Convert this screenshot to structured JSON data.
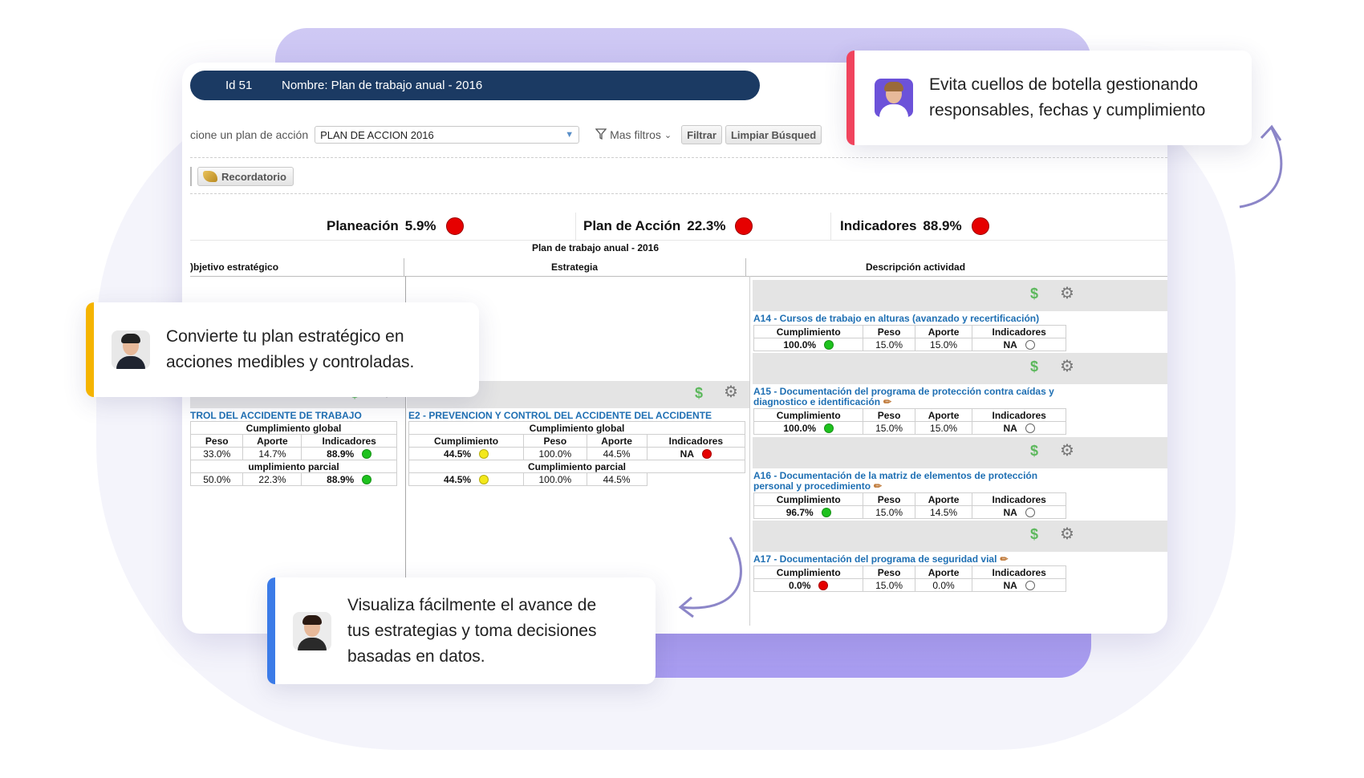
{
  "header": {
    "id_label": "Id 51",
    "name_label": "Nombre: Plan de trabajo anual - 2016"
  },
  "filters": {
    "plan_label": "cione un plan de acción",
    "plan_value": "PLAN DE ACCION 2016",
    "more_filters": "Mas filtros",
    "filter_button": "Filtrar",
    "clear_button": "Limpiar Búsqued"
  },
  "reminder_button": "Recordatorio",
  "kpis": [
    {
      "label": "Planeación",
      "value": "5.9%",
      "status_color": "#e60000"
    },
    {
      "label": "Plan de Acción",
      "value": "22.3%",
      "status_color": "#e60000"
    },
    {
      "label": "Indicadores",
      "value": "88.9%",
      "status_color": "#e60000"
    }
  ],
  "plan_title": "Plan de trabajo anual - 2016",
  "columns": {
    "objective": ")bjetivo estratégico",
    "strategy": "Estrategia",
    "activity": "Descripción actividad"
  },
  "objective": {
    "title": "TROL DEL ACCIDENTE DE TRABAJO",
    "global_label": "Cumplimiento global",
    "headers": [
      "Peso",
      "Aporte",
      "Indicadores"
    ],
    "global_row": [
      "33.0%",
      "14.7%",
      "88.9%"
    ],
    "partial_label": "umplimiento parcial",
    "partial_row": [
      "50.0%",
      "22.3%",
      "88.9%"
    ]
  },
  "strategy": {
    "title": "E2 - PREVENCION Y CONTROL DEL ACCIDENTE DEL ACCIDENTE",
    "global_label": "Cumplimiento global",
    "headers": [
      "Cumplimiento",
      "Peso",
      "Aporte",
      "Indicadores"
    ],
    "global_row": [
      "44.5%",
      "100.0%",
      "44.5%",
      "NA"
    ],
    "partial_label": "Cumplimiento parcial",
    "partial_row": [
      "44.5%",
      "100.0%",
      "44.5%"
    ]
  },
  "activity_headers": [
    "Cumplimiento",
    "Peso",
    "Aporte",
    "Indicadores"
  ],
  "activities": [
    {
      "title": "A14 - Cursos de trabajo en alturas (avanzado y recertificación)",
      "title2": "",
      "row": [
        "100.0%",
        "15.0%",
        "15.0%",
        "NA"
      ]
    },
    {
      "title": "A15 - Documentación del programa de protección contra caídas y",
      "title2": "diagnostico e identificación",
      "row": [
        "100.0%",
        "15.0%",
        "15.0%",
        "NA"
      ]
    },
    {
      "title": "A16 - Documentación de la matriz de elementos de protección",
      "title2": "personal y procedimiento",
      "row": [
        "96.7%",
        "15.0%",
        "14.5%",
        "NA"
      ]
    },
    {
      "title": "A17 - Documentación del programa de seguridad vial",
      "title2": "",
      "row": [
        "0.0%",
        "15.0%",
        "0.0%",
        "NA"
      ]
    }
  ],
  "icons": {
    "money": "$",
    "settings": "⚙",
    "pencil": "✏",
    "funnel": "⏷",
    "chevron": "⌄"
  },
  "callouts": {
    "top_right": {
      "line1": "Evita cuellos de botella gestionando",
      "line2": "responsables, fechas y cumplimiento",
      "accent": "#f0445d"
    },
    "left": {
      "line1": "Convierte tu plan estratégico en",
      "line2": "acciones medibles y controladas.",
      "accent": "#f5b400"
    },
    "bottom": {
      "line1": "Visualiza fácilmente el avance de",
      "line2": "tus estrategias y toma decisiones",
      "line3": "basadas en datos.",
      "accent": "#3b7be8"
    }
  }
}
